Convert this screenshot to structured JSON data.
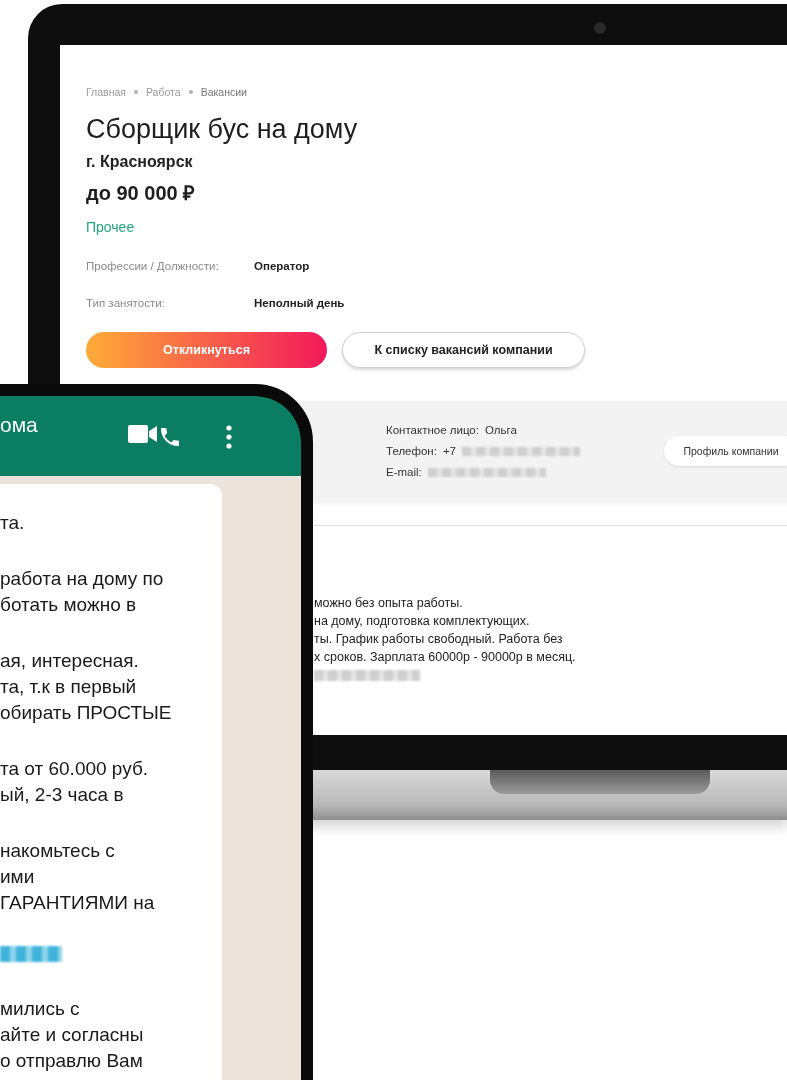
{
  "laptop_page": {
    "breadcrumbs": [
      {
        "label": "Главная",
        "selected": false
      },
      {
        "label": "Работа",
        "selected": false
      },
      {
        "label": "Вакансии",
        "selected": true
      }
    ],
    "title": "Сборщик бус на дому",
    "city": "г. Красноярск",
    "salary": "до 90 000 ₽",
    "category": "Прочее",
    "details": [
      {
        "label": "Профессии / Должности:",
        "value": "Оператор"
      },
      {
        "label": "Тип занятости:",
        "value": "Неполный день"
      }
    ],
    "buttons": [
      {
        "kind": "primary",
        "label": "Откликнуться"
      },
      {
        "kind": "outline",
        "label": "К списку вакансий компании"
      }
    ],
    "contact": [
      {
        "label": "Контактное лицо:",
        "value": "Ольга",
        "redacted": false
      },
      {
        "label": "Телефон:",
        "value": "+7",
        "redacted": true
      },
      {
        "label": "E-mail:",
        "redacted": true
      }
    ],
    "profile_button": "Профиль компании",
    "description": [
      {
        "kind": "text",
        "text": "можно без опыта работы."
      },
      {
        "kind": "text",
        "text": "на дому, подготовка комплектующих."
      },
      {
        "kind": "text",
        "text": "ты. График работы свободный. Работа без"
      },
      {
        "kind": "text",
        "text": "х сроков. Зарплата 60000р - 90000р в месяц."
      },
      {
        "kind": "redacted"
      }
    ]
  },
  "phone_chat": {
    "title": "ома",
    "message": [
      {
        "kind": "text",
        "lines": [
          "та."
        ]
      },
      {
        "kind": "text",
        "lines": [
          "работа на дому по",
          "ботать можно в"
        ]
      },
      {
        "kind": "text",
        "lines": [
          "ая, интересная.",
          "та, т.к в первый",
          "обирать ПРОСТЫЕ"
        ]
      },
      {
        "kind": "text",
        "lines": [
          "та от 60.000 руб.",
          "ый, 2-3 часа в"
        ]
      },
      {
        "kind": "text",
        "lines": [
          "накомьтесь с",
          "ими",
          "ГАРАНТИЯМИ на"
        ]
      },
      {
        "kind": "redacted"
      },
      {
        "kind": "text",
        "lines": [
          "мились с",
          "айте и согласны",
          "о отправлю Вам"
        ]
      }
    ]
  }
}
